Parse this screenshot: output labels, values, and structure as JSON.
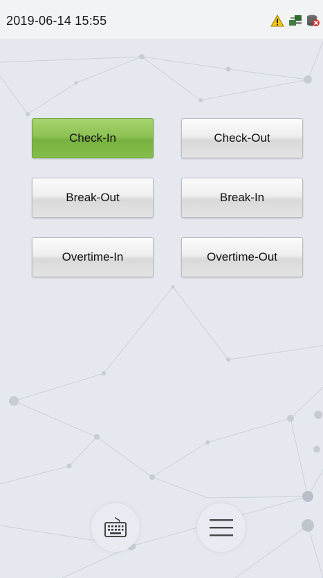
{
  "status_bar": {
    "datetime": "2019-06-14 15:55",
    "icons": [
      "warning-icon",
      "network-icon",
      "database-error-icon"
    ]
  },
  "punch_buttons": [
    {
      "label": "Check-In",
      "active": true
    },
    {
      "label": "Check-Out",
      "active": false
    },
    {
      "label": "Break-Out",
      "active": false
    },
    {
      "label": "Break-In",
      "active": false
    },
    {
      "label": "Overtime-In",
      "active": false
    },
    {
      "label": "Overtime-Out",
      "active": false
    }
  ],
  "bottom_bar": {
    "icons": [
      "keyboard-icon",
      "menu-icon"
    ]
  },
  "colors": {
    "active_button": "#8cc253",
    "warning": "#f2c811",
    "network": "#2f6b2f",
    "error": "#d9342b"
  }
}
